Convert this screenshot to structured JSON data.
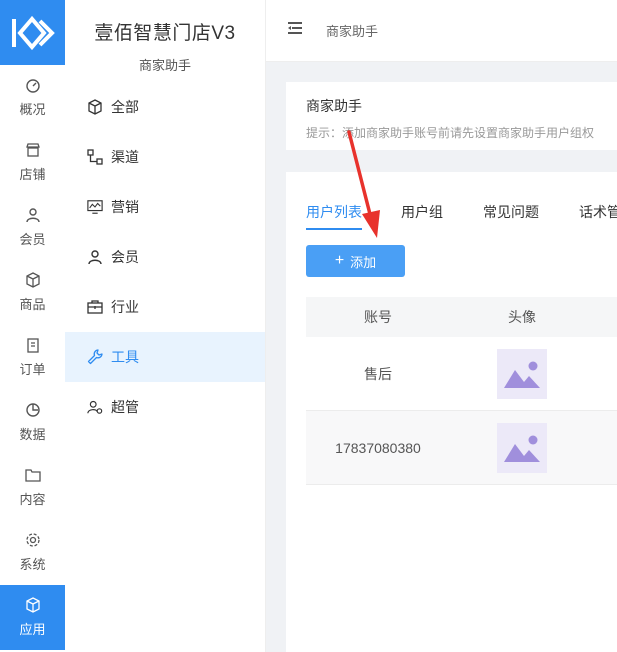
{
  "app": {
    "name": "壹佰智慧门店V3",
    "subtitle": "商家助手"
  },
  "rail": {
    "items": [
      {
        "label": "概况",
        "icon": "dashboard-icon"
      },
      {
        "label": "店铺",
        "icon": "store-icon"
      },
      {
        "label": "会员",
        "icon": "user-icon"
      },
      {
        "label": "商品",
        "icon": "box-icon"
      },
      {
        "label": "订单",
        "icon": "clipboard-icon"
      },
      {
        "label": "数据",
        "icon": "pie-icon"
      },
      {
        "label": "内容",
        "icon": "folder-icon"
      },
      {
        "label": "系统",
        "icon": "gear-icon"
      },
      {
        "label": "应用",
        "icon": "cube-icon",
        "active": true
      }
    ]
  },
  "menu": {
    "items": [
      {
        "label": "全部",
        "icon": "cube-icon"
      },
      {
        "label": "渠道",
        "icon": "channel-icon"
      },
      {
        "label": "营销",
        "icon": "monitor-chart-icon"
      },
      {
        "label": "会员",
        "icon": "user-icon"
      },
      {
        "label": "行业",
        "icon": "briefcase-icon"
      },
      {
        "label": "工具",
        "icon": "wrench-icon",
        "active": true
      },
      {
        "label": "超管",
        "icon": "admin-user-icon"
      }
    ]
  },
  "topbar": {
    "breadcrumb": "商家助手"
  },
  "intro": {
    "title": "商家助手",
    "tip": "提示：添加商家助手账号前请先设置商家助手用户组权"
  },
  "tabs": [
    "用户列表",
    "用户组",
    "常见问题",
    "话术管"
  ],
  "add_button": {
    "label": "添加"
  },
  "table": {
    "headers": [
      "账号",
      "头像"
    ],
    "rows": [
      {
        "account": "售后"
      },
      {
        "account": "17837080380"
      }
    ]
  },
  "colors": {
    "primary": "#2f8cf0",
    "annotation_arrow": "#e8322c"
  }
}
